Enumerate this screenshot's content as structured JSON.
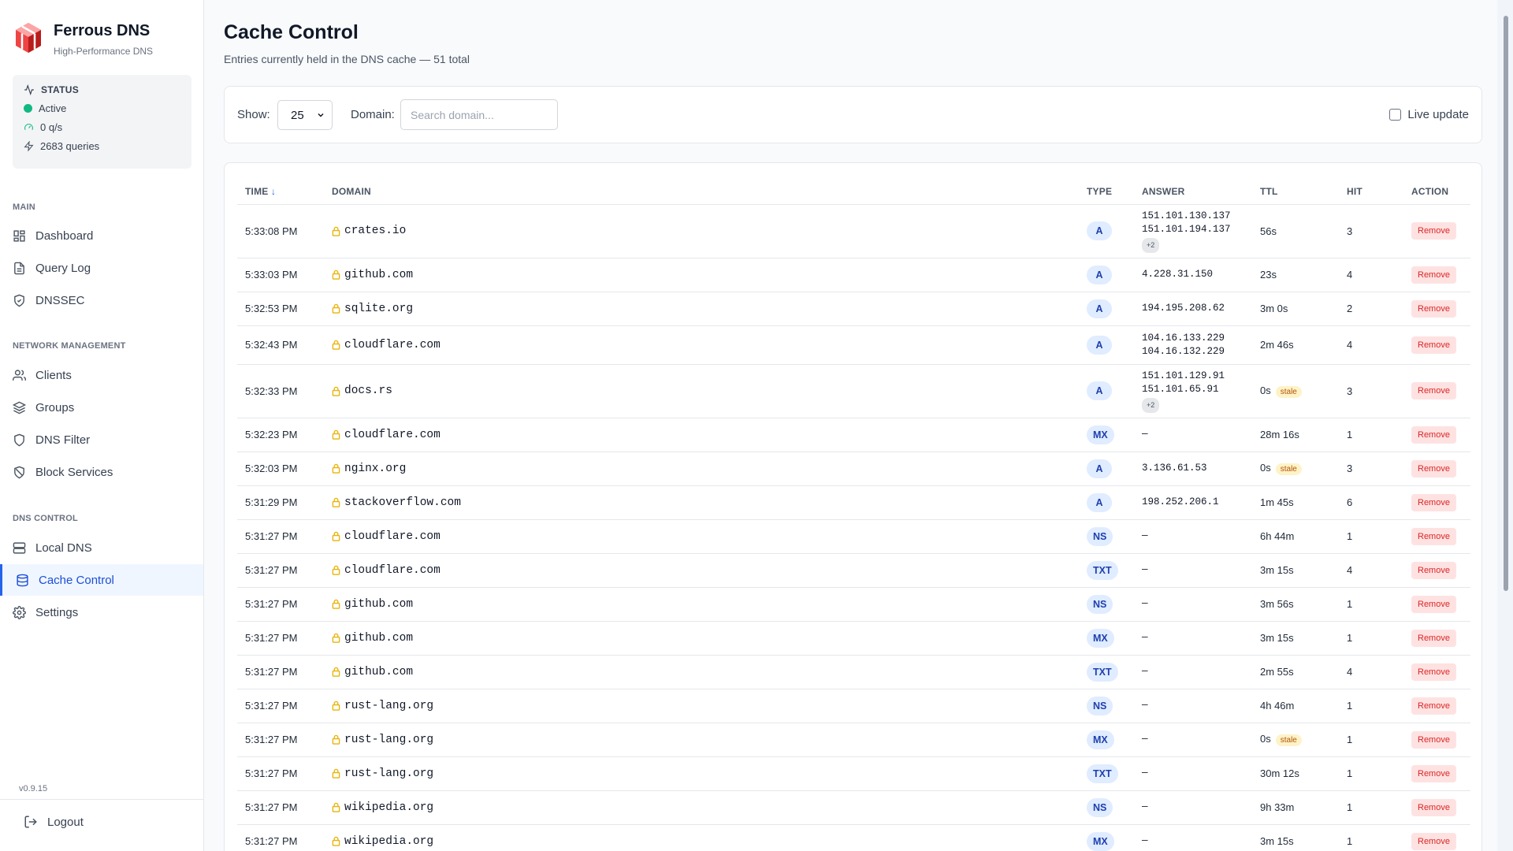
{
  "brand": {
    "title": "Ferrous DNS",
    "subtitle": "High-Performance DNS",
    "logo": "cube-logo-icon"
  },
  "status": {
    "heading": "STATUS",
    "state": "Active",
    "qps": "0 q/s",
    "queries": "2683 queries",
    "state_color": "#10b981"
  },
  "nav": {
    "main_label": "MAIN",
    "network_label": "NETWORK MANAGEMENT",
    "dns_label": "DNS CONTROL",
    "items": [
      {
        "label": "Dashboard",
        "icon": "grid-icon"
      },
      {
        "label": "Query Log",
        "icon": "file-text-icon"
      },
      {
        "label": "DNSSEC",
        "icon": "shield-check-icon"
      },
      {
        "label": "Clients",
        "icon": "users-icon"
      },
      {
        "label": "Groups",
        "icon": "layers-icon"
      },
      {
        "label": "DNS Filter",
        "icon": "shield-icon"
      },
      {
        "label": "Block Services",
        "icon": "shield-off-icon"
      },
      {
        "label": "Local DNS",
        "icon": "server-icon"
      },
      {
        "label": "Cache Control",
        "icon": "database-icon"
      },
      {
        "label": "Settings",
        "icon": "gear-icon"
      }
    ],
    "active": "Cache Control"
  },
  "version": "v0.9.15",
  "logout_label": "Logout",
  "page": {
    "title": "Cache Control",
    "subtitle": "Entries currently held in the DNS cache — 51 total"
  },
  "filters": {
    "show_label": "Show:",
    "show_value": "25",
    "domain_label": "Domain:",
    "domain_placeholder": "Search domain...",
    "live_label": "Live update",
    "live_checked": false
  },
  "table": {
    "columns": [
      "TIME",
      "DOMAIN",
      "TYPE",
      "ANSWER",
      "TTL",
      "HIT",
      "ACTION"
    ],
    "sort_indicator": "↓",
    "remove_label": "Remove",
    "stale_label": "stale",
    "rows": [
      {
        "time": "5:33:08 PM",
        "domain": "crates.io",
        "type": "A",
        "answers": [
          "151.101.130.137",
          "151.101.194.137"
        ],
        "more": "+2",
        "ttl": "56s",
        "stale": false,
        "hit": "3"
      },
      {
        "time": "5:33:03 PM",
        "domain": "github.com",
        "type": "A",
        "answers": [
          "4.228.31.150"
        ],
        "more": "",
        "ttl": "23s",
        "stale": false,
        "hit": "4"
      },
      {
        "time": "5:32:53 PM",
        "domain": "sqlite.org",
        "type": "A",
        "answers": [
          "194.195.208.62"
        ],
        "more": "",
        "ttl": "3m 0s",
        "stale": false,
        "hit": "2"
      },
      {
        "time": "5:32:43 PM",
        "domain": "cloudflare.com",
        "type": "A",
        "answers": [
          "104.16.133.229",
          "104.16.132.229"
        ],
        "more": "",
        "ttl": "2m 46s",
        "stale": false,
        "hit": "4"
      },
      {
        "time": "5:32:33 PM",
        "domain": "docs.rs",
        "type": "A",
        "answers": [
          "151.101.129.91",
          "151.101.65.91"
        ],
        "more": "+2",
        "ttl": "0s",
        "stale": true,
        "hit": "3"
      },
      {
        "time": "5:32:23 PM",
        "domain": "cloudflare.com",
        "type": "MX",
        "answers": [
          "—"
        ],
        "more": "",
        "ttl": "28m 16s",
        "stale": false,
        "hit": "1"
      },
      {
        "time": "5:32:03 PM",
        "domain": "nginx.org",
        "type": "A",
        "answers": [
          "3.136.61.53"
        ],
        "more": "",
        "ttl": "0s",
        "stale": true,
        "hit": "3"
      },
      {
        "time": "5:31:29 PM",
        "domain": "stackoverflow.com",
        "type": "A",
        "answers": [
          "198.252.206.1"
        ],
        "more": "",
        "ttl": "1m 45s",
        "stale": false,
        "hit": "6"
      },
      {
        "time": "5:31:27 PM",
        "domain": "cloudflare.com",
        "type": "NS",
        "answers": [
          "—"
        ],
        "more": "",
        "ttl": "6h 44m",
        "stale": false,
        "hit": "1"
      },
      {
        "time": "5:31:27 PM",
        "domain": "cloudflare.com",
        "type": "TXT",
        "answers": [
          "—"
        ],
        "more": "",
        "ttl": "3m 15s",
        "stale": false,
        "hit": "4"
      },
      {
        "time": "5:31:27 PM",
        "domain": "github.com",
        "type": "NS",
        "answers": [
          "—"
        ],
        "more": "",
        "ttl": "3m 56s",
        "stale": false,
        "hit": "1"
      },
      {
        "time": "5:31:27 PM",
        "domain": "github.com",
        "type": "MX",
        "answers": [
          "—"
        ],
        "more": "",
        "ttl": "3m 15s",
        "stale": false,
        "hit": "1"
      },
      {
        "time": "5:31:27 PM",
        "domain": "github.com",
        "type": "TXT",
        "answers": [
          "—"
        ],
        "more": "",
        "ttl": "2m 55s",
        "stale": false,
        "hit": "4"
      },
      {
        "time": "5:31:27 PM",
        "domain": "rust-lang.org",
        "type": "NS",
        "answers": [
          "—"
        ],
        "more": "",
        "ttl": "4h 46m",
        "stale": false,
        "hit": "1"
      },
      {
        "time": "5:31:27 PM",
        "domain": "rust-lang.org",
        "type": "MX",
        "answers": [
          "—"
        ],
        "more": "",
        "ttl": "0s",
        "stale": true,
        "hit": "1"
      },
      {
        "time": "5:31:27 PM",
        "domain": "rust-lang.org",
        "type": "TXT",
        "answers": [
          "—"
        ],
        "more": "",
        "ttl": "30m 12s",
        "stale": false,
        "hit": "1"
      },
      {
        "time": "5:31:27 PM",
        "domain": "wikipedia.org",
        "type": "NS",
        "answers": [
          "—"
        ],
        "more": "",
        "ttl": "9h 33m",
        "stale": false,
        "hit": "1"
      },
      {
        "time": "5:31:27 PM",
        "domain": "wikipedia.org",
        "type": "MX",
        "answers": [
          "—"
        ],
        "more": "",
        "ttl": "3m 15s",
        "stale": false,
        "hit": "1"
      }
    ]
  },
  "colors": {
    "accent": "#2563eb",
    "remove": "#dc2626",
    "stale": "#b45309",
    "lock": "#eab308"
  }
}
